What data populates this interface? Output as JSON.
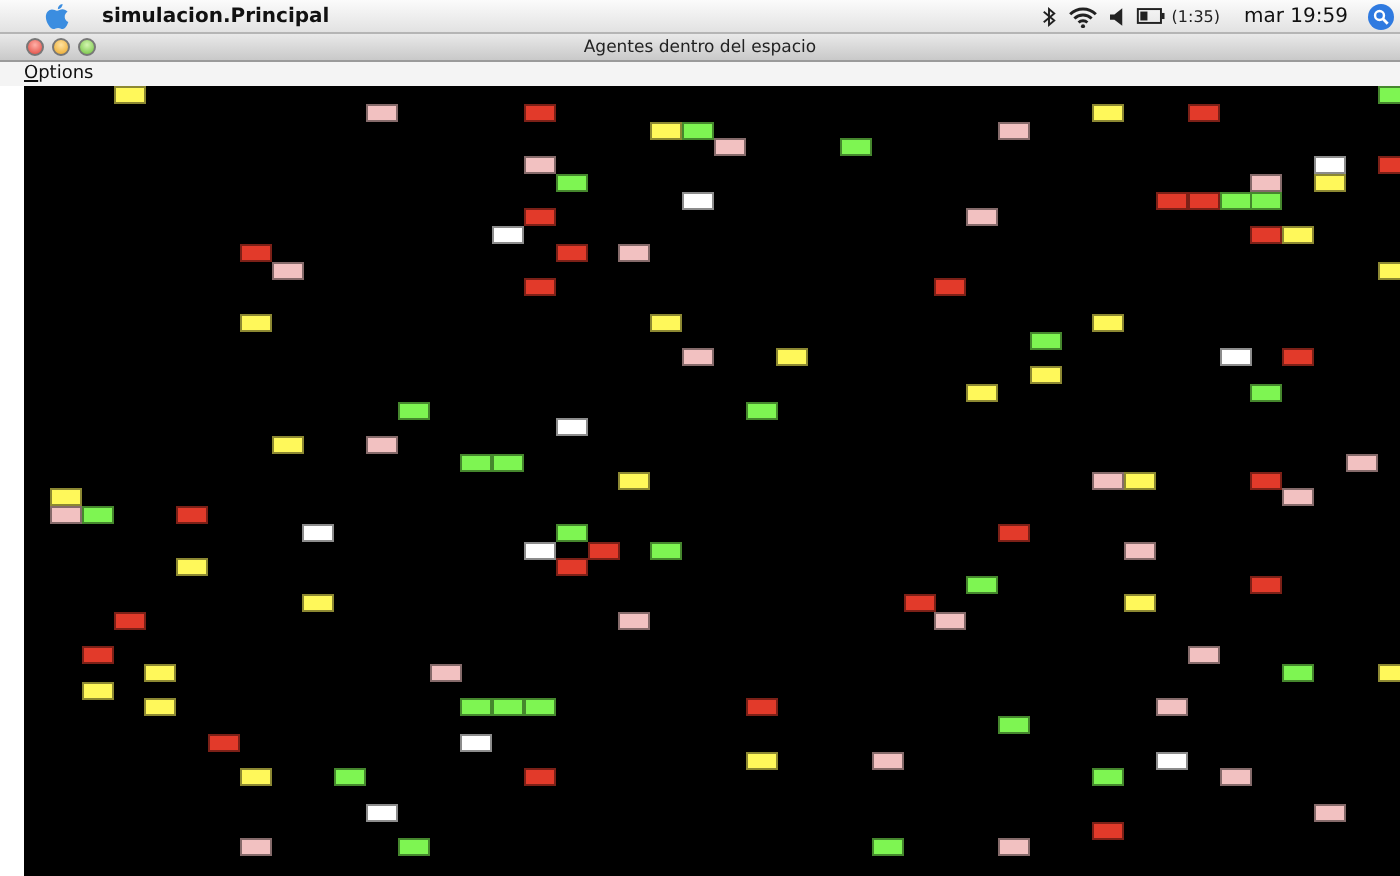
{
  "menubar": {
    "app_name": "simulacion.Principal",
    "battery_time": "(1:35)",
    "clock": "mar 19:59"
  },
  "window": {
    "title": "Agentes dentro del espacio",
    "menu": [
      "Options"
    ]
  },
  "agents": [
    {
      "color": "#fff85a"
    },
    {
      "color": "#7ef552"
    },
    {
      "color": "#f2c1c1"
    },
    {
      "color": "#e23a2a"
    },
    {
      "color": "#fff85a"
    },
    {
      "color": "#e23a2a"
    },
    {
      "color": "#fff85a"
    },
    {
      "color": "#7ef552"
    },
    {
      "color": "#f2c1c1"
    },
    {
      "color": "#f2c1c1"
    },
    {
      "color": "#7ef552"
    },
    {
      "color": "#f2c1c1"
    },
    {
      "color": "#ffffff"
    },
    {
      "color": "#e23a2a"
    },
    {
      "color": "#7ef552"
    },
    {
      "color": "#f2c1c1"
    },
    {
      "color": "#fff85a"
    },
    {
      "color": "#ffffff"
    },
    {
      "color": "#e23a2a"
    },
    {
      "color": "#e23a2a"
    },
    {
      "color": "#7ef552"
    },
    {
      "color": "#7ef552"
    },
    {
      "color": "#e23a2a"
    },
    {
      "color": "#f2c1c1"
    },
    {
      "color": "#ffffff"
    },
    {
      "color": "#e23a2a"
    },
    {
      "color": "#fff85a"
    },
    {
      "color": "#e23a2a"
    },
    {
      "color": "#e23a2a"
    },
    {
      "color": "#f2c1c1"
    },
    {
      "color": "#f2c1c1"
    },
    {
      "color": "#fff85a"
    },
    {
      "color": "#e23a2a"
    },
    {
      "color": "#e23a2a"
    },
    {
      "color": "#fff85a"
    },
    {
      "color": "#fff85a"
    },
    {
      "color": "#fff85a"
    },
    {
      "color": "#7ef552"
    },
    {
      "color": "#f2c1c1"
    },
    {
      "color": "#fff85a"
    },
    {
      "color": "#ffffff"
    },
    {
      "color": "#e23a2a"
    },
    {
      "color": "#fff85a"
    },
    {
      "color": "#fff85a"
    },
    {
      "color": "#7ef552"
    },
    {
      "color": "#7ef552"
    },
    {
      "color": "#7ef552"
    },
    {
      "color": "#ffffff"
    },
    {
      "color": "#fff85a"
    },
    {
      "color": "#f2c1c1"
    },
    {
      "color": "#7ef552"
    },
    {
      "color": "#7ef552"
    },
    {
      "color": "#f2c1c1"
    },
    {
      "color": "#fff85a"
    },
    {
      "color": "#f2c1c1"
    },
    {
      "color": "#fff85a"
    },
    {
      "color": "#e23a2a"
    },
    {
      "color": "#fff85a"
    },
    {
      "color": "#f2c1c1"
    },
    {
      "color": "#f2c1c1"
    },
    {
      "color": "#7ef552"
    },
    {
      "color": "#e23a2a"
    },
    {
      "color": "#ffffff"
    },
    {
      "color": "#7ef552"
    },
    {
      "color": "#e23a2a"
    },
    {
      "color": "#ffffff"
    },
    {
      "color": "#e23a2a"
    },
    {
      "color": "#7ef552"
    },
    {
      "color": "#f2c1c1"
    },
    {
      "color": "#fff85a"
    },
    {
      "color": "#e23a2a"
    },
    {
      "color": "#7ef552"
    },
    {
      "color": "#e23a2a"
    },
    {
      "color": "#fff85a"
    },
    {
      "color": "#e23a2a"
    },
    {
      "color": "#fff85a"
    },
    {
      "color": "#e23a2a"
    },
    {
      "color": "#f2c1c1"
    },
    {
      "color": "#f2c1c1"
    },
    {
      "color": "#e23a2a"
    },
    {
      "color": "#f2c1c1"
    },
    {
      "color": "#fff85a"
    },
    {
      "color": "#f2c1c1"
    },
    {
      "color": "#7ef552"
    },
    {
      "color": "#fff85a"
    },
    {
      "color": "#fff85a"
    },
    {
      "color": "#fff85a"
    },
    {
      "color": "#7ef552"
    },
    {
      "color": "#7ef552"
    },
    {
      "color": "#7ef552"
    },
    {
      "color": "#e23a2a"
    },
    {
      "color": "#f2c1c1"
    },
    {
      "color": "#7ef552"
    },
    {
      "color": "#e23a2a"
    },
    {
      "color": "#ffffff"
    },
    {
      "color": "#fff85a"
    },
    {
      "color": "#f2c1c1"
    },
    {
      "color": "#ffffff"
    },
    {
      "color": "#fff85a"
    },
    {
      "color": "#7ef552"
    },
    {
      "color": "#e23a2a"
    },
    {
      "color": "#7ef552"
    },
    {
      "color": "#f2c1c1"
    },
    {
      "color": "#ffffff"
    },
    {
      "color": "#f2c1c1"
    },
    {
      "color": "#e23a2a"
    },
    {
      "color": "#f2c1c1"
    },
    {
      "color": "#7ef552"
    },
    {
      "color": "#7ef552"
    },
    {
      "color": "#f2c1c1"
    }
  ]
}
